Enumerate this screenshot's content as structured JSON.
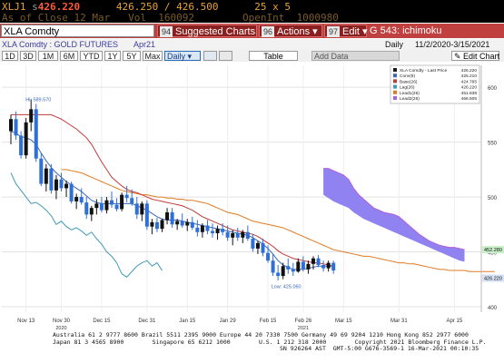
{
  "terminal": {
    "ticker": "XLJ1",
    "ticker_suffix": "s",
    "last_price": "426.220",
    "bid_ask": "426.250 / 426.500",
    "size": "25 x 5",
    "as_of": "As of Close 12 Mar",
    "vol_label": "Vol",
    "vol_value": "160092",
    "openint_label": "OpenInt",
    "openint_value": "1000980"
  },
  "toolbar": {
    "security": "XLA Comdty",
    "suggested_num": "94",
    "suggested_label": "Suggested Charts",
    "actions_num": "96",
    "actions_label": "Actions",
    "edit_num": "97",
    "edit_label": "Edit",
    "function_label": "G 543: ichimoku"
  },
  "subheader": {
    "name": "XLA Comdty : GOLD FUTURES",
    "contract": "Apr21",
    "periodicity": "Daily",
    "range": "11/2/2020-3/15/2021"
  },
  "controls": {
    "periods": [
      "1D",
      "3D",
      "1M",
      "6M",
      "YTD",
      "1Y",
      "5Y",
      "Max"
    ],
    "daily": "Daily",
    "table": "Table",
    "add_data": "Add Data",
    "edit_chart": "Edit Chart"
  },
  "legend": {
    "items": [
      {
        "label": "XLA Comdty - Last Price",
        "value": "426.220",
        "color": "#1a1a1a"
      },
      {
        "label": "Conv(9)",
        "value": "425.210",
        "color": "#3a68b8"
      },
      {
        "label": "Base(26)",
        "value": "424.765",
        "color": "#c23a3a"
      },
      {
        "label": "Lag(26)",
        "value": "426.220",
        "color": "#3e9ab8"
      },
      {
        "label": "Lead1(26)",
        "value": "451.838",
        "color": "#e07a22"
      },
      {
        "label": "Lead2(26)",
        "value": "466.505",
        "color": "#b060d8"
      }
    ]
  },
  "annotations": {
    "hi_label": "Hi: 589.570",
    "low_label": "Low: 425.060",
    "price_tag_1": "452.280",
    "price_tag_2": "426.220"
  },
  "footer": {
    "line1": "Australia 61 2 9777 8600 Brazil 5511 2395 9000 Europe 44 20 7330 7500 Germany 49 69 9204 1210 Hong Kong 852 2977 6000",
    "line2": "Japan 81 3 4565 8900        Singapore 65 6212 1000        U.S. 1 212 318 2000        Copyright 2021 Bloomberg Finance L.P.",
    "line3": "SN 926264 AST  GMT-5:00 G676-3569-1 16-Mar-2021 00:10:35"
  },
  "colors": {
    "terminal_bg": "#000000",
    "amber": "#e8a23a",
    "toolbar_red": "#c04040",
    "cloud": "#8a7cf0"
  },
  "chart_data": {
    "type": "candlestick",
    "title": "",
    "xlabel": "",
    "ylabel": "",
    "ylim": [
      395,
      620
    ],
    "y_ticks": [
      400,
      450,
      500,
      550,
      600
    ],
    "x_ticks": [
      "Nov 13",
      "Nov 30",
      "Dec 15",
      "Dec 31",
      "Jan 15",
      "Jan 29",
      "Feb 15",
      "Feb 26",
      "Mar 15",
      "Mar 31",
      "Apr 15"
    ],
    "x_tick_sub": {
      "Nov 30": "2020",
      "Feb 26": "2021"
    },
    "candles": [
      [
        560,
        575,
        548,
        571
      ],
      [
        571,
        578,
        552,
        556
      ],
      [
        556,
        560,
        535,
        538
      ],
      [
        538,
        572,
        535,
        568
      ],
      [
        568,
        589,
        560,
        580
      ],
      [
        580,
        585,
        532,
        535
      ],
      [
        535,
        540,
        510,
        512
      ],
      [
        512,
        530,
        505,
        526
      ],
      [
        526,
        530,
        503,
        506
      ],
      [
        506,
        520,
        498,
        516
      ],
      [
        516,
        522,
        505,
        508
      ],
      [
        508,
        515,
        500,
        512
      ],
      [
        512,
        514,
        494,
        496
      ],
      [
        496,
        503,
        489,
        500
      ],
      [
        500,
        508,
        493,
        495
      ],
      [
        495,
        500,
        480,
        484
      ],
      [
        484,
        492,
        478,
        490
      ],
      [
        490,
        498,
        484,
        494
      ],
      [
        494,
        500,
        486,
        488
      ],
      [
        488,
        500,
        485,
        497
      ],
      [
        497,
        505,
        490,
        493
      ],
      [
        493,
        499,
        487,
        489
      ],
      [
        489,
        504,
        487,
        502
      ],
      [
        502,
        510,
        495,
        499
      ],
      [
        499,
        507,
        492,
        494
      ],
      [
        494,
        500,
        480,
        484
      ],
      [
        484,
        496,
        478,
        494
      ],
      [
        494,
        497,
        470,
        473
      ],
      [
        473,
        480,
        466,
        477
      ],
      [
        477,
        481,
        468,
        471
      ],
      [
        471,
        480,
        468,
        479
      ],
      [
        479,
        490,
        475,
        486
      ],
      [
        486,
        490,
        472,
        475
      ],
      [
        475,
        480,
        470,
        478
      ],
      [
        478,
        485,
        472,
        474
      ],
      [
        474,
        480,
        469,
        477
      ],
      [
        477,
        482,
        470,
        472
      ],
      [
        472,
        479,
        464,
        468
      ],
      [
        468,
        476,
        463,
        474
      ],
      [
        474,
        479,
        466,
        469
      ],
      [
        469,
        476,
        463,
        467
      ],
      [
        467,
        474,
        461,
        471
      ],
      [
        471,
        476,
        465,
        468
      ],
      [
        468,
        474,
        460,
        463
      ],
      [
        463,
        470,
        456,
        467
      ],
      [
        467,
        472,
        460,
        463
      ],
      [
        463,
        470,
        458,
        468
      ],
      [
        468,
        474,
        460,
        462
      ],
      [
        462,
        466,
        450,
        453
      ],
      [
        453,
        460,
        448,
        458
      ],
      [
        458,
        462,
        446,
        449
      ],
      [
        449,
        456,
        440,
        442
      ],
      [
        442,
        448,
        428,
        431
      ],
      [
        431,
        438,
        424,
        428
      ],
      [
        428,
        440,
        425,
        437
      ],
      [
        437,
        444,
        430,
        434
      ],
      [
        434,
        440,
        428,
        432
      ],
      [
        432,
        444,
        431,
        441
      ],
      [
        441,
        446,
        432,
        434
      ],
      [
        434,
        442,
        430,
        439
      ],
      [
        439,
        446,
        434,
        444
      ],
      [
        444,
        447,
        436,
        438
      ],
      [
        438,
        442,
        432,
        435
      ],
      [
        435,
        442,
        432,
        440
      ],
      [
        440,
        442,
        430,
        433
      ]
    ],
    "series": [
      {
        "name": "Conv(9)",
        "values": [
          560,
          558,
          555,
          554,
          552,
          548,
          540,
          533,
          527,
          522,
          518,
          514,
          511,
          508,
          505,
          501,
          497,
          495,
          494,
          494,
          494,
          494,
          494,
          494,
          494,
          492,
          490,
          488,
          485,
          482,
          480,
          479,
          479,
          479,
          478,
          477,
          476,
          475,
          474,
          473,
          472,
          471,
          470,
          469,
          468,
          467,
          466,
          465,
          463,
          460,
          457,
          453,
          448,
          442,
          438,
          436,
          434,
          434,
          434,
          435,
          436,
          437,
          437,
          437,
          437
        ]
      },
      {
        "name": "Base(26)",
        "values": [
          575,
          575,
          575,
          575,
          575,
          575,
          575,
          575,
          575,
          573,
          571,
          568,
          565,
          562,
          558,
          554,
          548,
          540,
          532,
          525,
          518,
          514,
          510,
          507,
          505,
          504,
          502,
          500,
          498,
          497,
          496,
          495,
          494,
          493,
          492,
          490,
          488,
          485,
          482,
          480,
          478,
          476,
          474,
          472,
          470,
          469,
          468,
          467,
          466,
          464,
          461,
          458,
          455,
          451,
          448,
          446,
          444,
          443,
          442,
          441,
          440,
          440,
          439,
          438,
          437
        ]
      },
      {
        "name": "Lag(26)",
        "values": [
          522,
          512,
          506,
          500,
          494,
          495,
          492,
          488,
          483,
          475,
          478,
          473,
          470,
          472,
          469,
          465,
          468,
          462,
          457,
          450,
          446,
          440,
          430,
          427,
          432,
          437,
          440,
          442,
          437,
          440,
          433
        ]
      }
    ],
    "cloud_lead1": [
      null,
      null,
      null,
      null,
      null,
      null,
      null,
      null,
      null,
      null,
      null,
      null,
      null,
      null,
      null,
      null,
      null,
      null,
      null,
      null,
      null,
      null,
      null,
      null,
      null,
      null,
      null,
      null,
      null,
      null,
      null,
      null,
      null,
      null,
      null,
      null,
      null,
      null,
      null,
      null,
      null,
      null,
      null,
      null,
      null,
      null,
      null,
      null,
      null,
      null,
      null,
      null,
      null,
      null,
      null,
      null,
      null,
      null,
      null,
      null,
      null,
      null,
      null,
      null,
      null
    ],
    "lead1": [
      525,
      525,
      524,
      523,
      522,
      520,
      518,
      516,
      514,
      512,
      510,
      508,
      506,
      505,
      504,
      503,
      502,
      502,
      501,
      500,
      500,
      499,
      499,
      498,
      498,
      497,
      497,
      496,
      495,
      494,
      492,
      490,
      488,
      486,
      485,
      484,
      482,
      480,
      478,
      477,
      476,
      475,
      474,
      473,
      472,
      470,
      468,
      466,
      464,
      462,
      460,
      458,
      456,
      454,
      452,
      451,
      450,
      449,
      448,
      447,
      446,
      446,
      445,
      444,
      443,
      442,
      441,
      440,
      440,
      439,
      439,
      438,
      437,
      436,
      435,
      434,
      434,
      433,
      433,
      433,
      433,
      432,
      432,
      432,
      432,
      432,
      432
    ],
    "lead2": [
      null,
      null,
      null,
      null,
      null,
      null,
      null,
      null,
      null,
      null,
      null,
      null,
      null,
      null,
      null,
      null,
      null,
      null,
      null,
      null,
      null,
      null,
      null,
      null,
      null,
      null,
      null,
      null,
      null,
      null,
      null,
      null,
      null,
      null,
      null,
      null,
      null,
      null,
      null,
      null,
      null,
      null,
      null,
      null,
      null,
      null,
      null,
      null,
      null,
      null,
      null,
      null,
      null,
      null,
      null,
      null,
      null,
      null,
      null,
      null,
      null,
      null,
      null,
      null,
      null,
      null,
      null,
      null,
      null,
      null,
      null,
      null,
      null,
      null,
      null,
      null,
      null,
      null,
      null,
      null,
      null,
      null,
      null,
      null,
      null,
      null,
      null
    ],
    "cloud": {
      "start_index": 62,
      "upper": [
        526,
        526,
        524,
        522,
        520,
        516,
        508,
        502,
        498,
        494,
        490,
        488,
        486,
        485,
        484,
        482,
        478,
        474,
        470,
        466,
        463,
        460,
        458,
        456,
        455,
        454,
        454,
        453,
        452
      ],
      "lower": [
        502,
        499,
        496,
        494,
        492,
        490,
        486,
        483,
        480,
        478,
        476,
        474,
        472,
        470,
        468,
        466,
        464,
        462,
        460,
        458,
        456,
        454,
        452,
        450,
        448,
        446,
        444,
        442,
        441
      ]
    }
  }
}
